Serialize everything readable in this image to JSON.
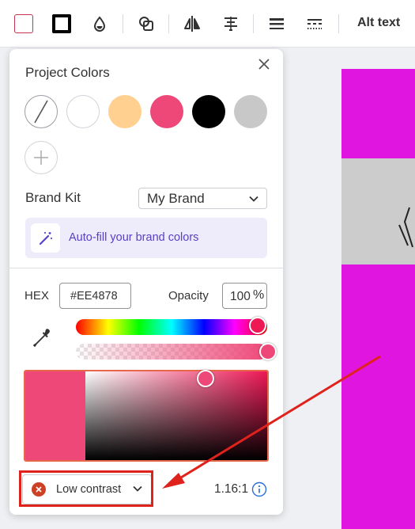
{
  "colors": {
    "selected": "#EE4878",
    "magenta": "#E016E0",
    "grey_band": "#CCCCCC",
    "brand_purple": "#5A40C4",
    "annotation_red": "#E0221D"
  },
  "toolbar": {
    "alt_text": "Alt text",
    "icons": [
      "fill-color",
      "stroke-color",
      "transparency-drop",
      "shape-combine",
      "flip-horizontal",
      "align-center",
      "line-weight",
      "line-dash"
    ]
  },
  "panel": {
    "title": "Project Colors",
    "swatches": [
      {
        "name": "none",
        "color": "transparent"
      },
      {
        "name": "white",
        "color": "#FFFFFF"
      },
      {
        "name": "peach",
        "color": "#FFD08F"
      },
      {
        "name": "pink",
        "color": "#EE4878"
      },
      {
        "name": "black",
        "color": "#000000"
      },
      {
        "name": "grey",
        "color": "#C8C8C8"
      }
    ],
    "brand_kit_label": "Brand Kit",
    "brand_kit_value": "My Brand",
    "autofill_label": "Auto-fill your brand colors",
    "hex_label": "HEX",
    "hex_value": "#EE4878",
    "opacity_label": "Opacity",
    "opacity_value": "100",
    "opacity_unit": "%",
    "contrast_label": "Low contrast",
    "contrast_ratio": "1.16:1"
  }
}
